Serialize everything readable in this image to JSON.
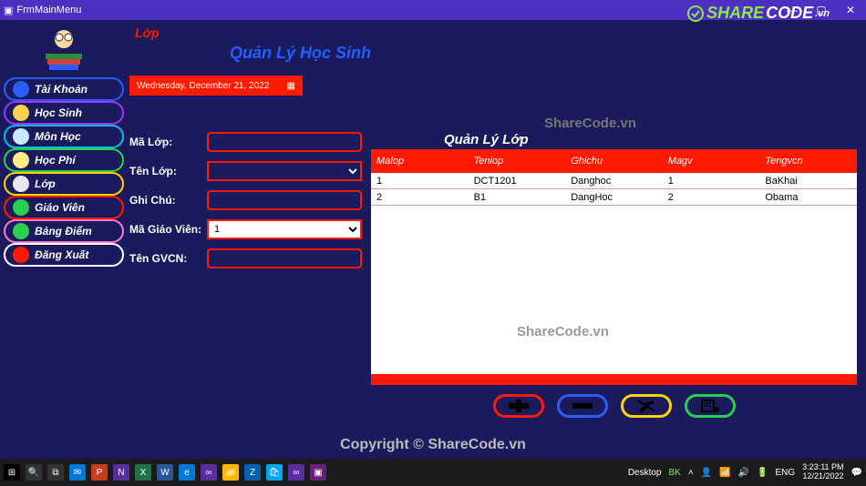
{
  "window": {
    "title": "FrmMainMenu"
  },
  "watermark_logo": {
    "green": "SHARE",
    "white": "CODE",
    "suffix": ".vn"
  },
  "sidebar": {
    "items": [
      {
        "label": "Tài Khoản",
        "border": "#2a5cff",
        "icon_bg": "#2a5cff"
      },
      {
        "label": "Học Sinh",
        "border": "#a030ff",
        "icon_bg": "#ffd24d"
      },
      {
        "label": "Môn Học",
        "border": "#00c0e0",
        "icon_bg": "#c8e8ff"
      },
      {
        "label": "Học Phí",
        "border": "#28d050",
        "icon_bg": "#ffee88"
      },
      {
        "label": "Lớp",
        "border": "#ffd400",
        "icon_bg": "#e8e8f0"
      },
      {
        "label": "Giáo Viên",
        "border": "#ff1a00",
        "icon_bg": "#28d050"
      },
      {
        "label": "Bảng Điểm",
        "border": "#ff7ac8",
        "icon_bg": "#28d050"
      },
      {
        "label": "Đăng Xuất",
        "border": "#ffffff",
        "icon_bg": "#ff1a00"
      }
    ]
  },
  "headings": {
    "section": "Lớp",
    "main": "Quản Lý Học Sinh"
  },
  "date_display": "Wednesday, December 21, 2022",
  "form": {
    "malop_label": "Mã Lớp:",
    "tenlop_label": "Tên Lớp:",
    "ghichu_label": "Ghi Chú:",
    "magv_label": "Mã Giáo Viên:",
    "magv_value": "1",
    "gvcn_label": "Tên GVCN:"
  },
  "table": {
    "title": "Quản Lý Lớp",
    "columns": [
      "Malop",
      "Tenlop",
      "Ghichu",
      "Magv",
      "Tengvcn"
    ],
    "rows": [
      {
        "Malop": "1",
        "Tenlop": "DCT1201",
        "Ghichu": "Danghoc",
        "Magv": "1",
        "Tengvcn": "BaKhai"
      },
      {
        "Malop": "2",
        "Tenlop": "B1",
        "Ghichu": "DangHoc",
        "Magv": "2",
        "Tengvcn": "Obama"
      }
    ]
  },
  "watermarks": {
    "wm1": "ShareCode.vn",
    "wm2": "ShareCode.vn",
    "copyright": "Copyright © ShareCode.vn"
  },
  "taskbar": {
    "desktop_label": "Desktop",
    "user": "BK",
    "lang": "ENG",
    "time": "3:23:11 PM",
    "date": "12/21/2022"
  }
}
